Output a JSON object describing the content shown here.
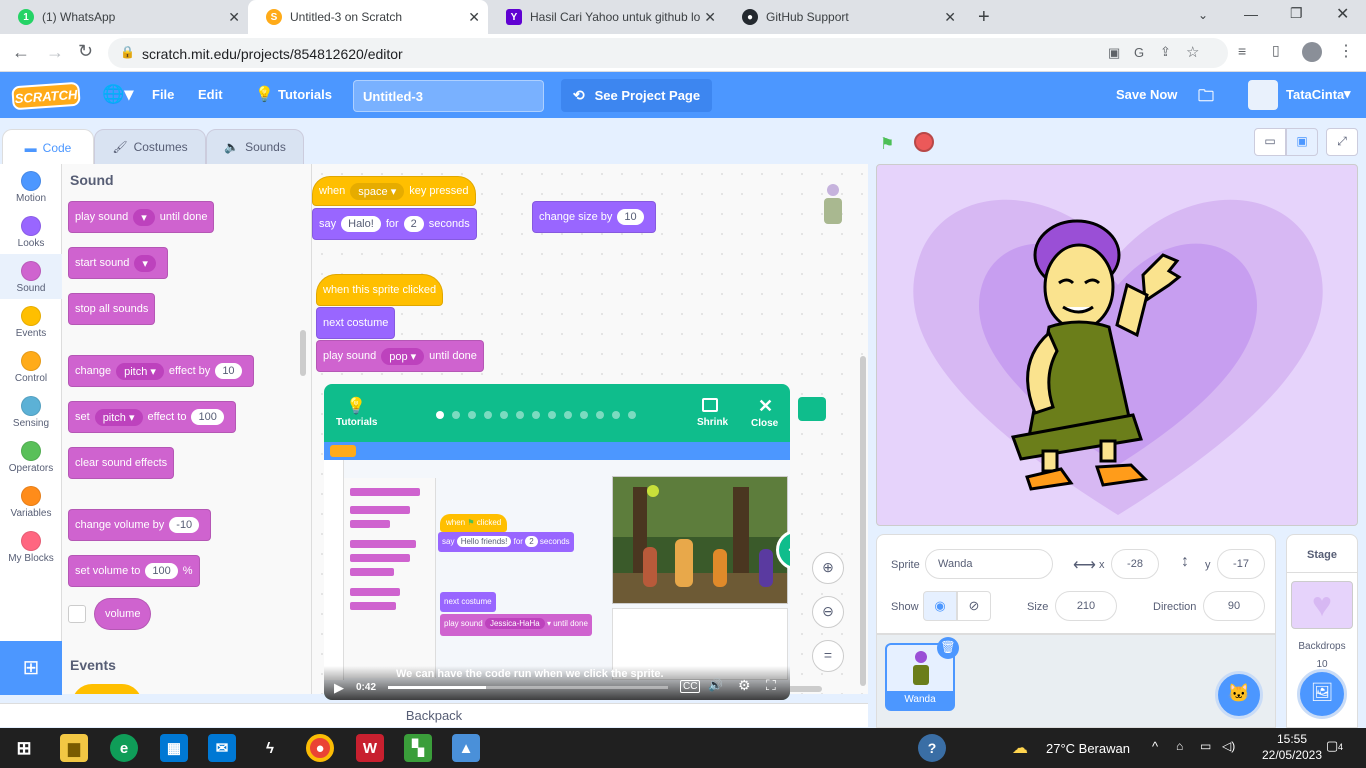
{
  "browser": {
    "tabs": [
      {
        "title": "(1) WhatsApp",
        "color": "#25d366",
        "glyph": "1"
      },
      {
        "title": "Untitled-3 on Scratch",
        "color": "#ffab19",
        "glyph": "S"
      },
      {
        "title": "Hasil Cari Yahoo untuk github log",
        "color": "#6001d2",
        "glyph": "Y"
      },
      {
        "title": "GitHub Support",
        "color": "#24292f",
        "glyph": "●"
      }
    ],
    "url": "scratch.mit.edu/projects/854812620/editor"
  },
  "menubar": {
    "logo": "SCRATCH",
    "file": "File",
    "edit": "Edit",
    "tutorials": "Tutorials",
    "project_title": "Untitled-3",
    "see_project": "See Project Page",
    "save_now": "Save Now",
    "username": "TataCinta"
  },
  "editor_tabs": {
    "code": "Code",
    "costumes": "Costumes",
    "sounds": "Sounds"
  },
  "categories": [
    {
      "label": "Motion",
      "color": "#4c97ff"
    },
    {
      "label": "Looks",
      "color": "#9966ff"
    },
    {
      "label": "Sound",
      "color": "#cf63cf"
    },
    {
      "label": "Events",
      "color": "#ffbf00"
    },
    {
      "label": "Control",
      "color": "#ffab19"
    },
    {
      "label": "Sensing",
      "color": "#5cb1d6"
    },
    {
      "label": "Operators",
      "color": "#59c059"
    },
    {
      "label": "Variables",
      "color": "#ff8c1a"
    },
    {
      "label": "My Blocks",
      "color": "#ff6680"
    }
  ],
  "palette": {
    "sound_heading": "Sound",
    "play_sound": "play sound",
    "until_done": "until done",
    "start_sound": "start sound",
    "stop_all": "stop all sounds",
    "change": "change",
    "pitch": "pitch",
    "effect_by": "effect by",
    "effect_by_value": "10",
    "set": "set",
    "effect_to": "effect to",
    "effect_to_value": "100",
    "clear_effects": "clear sound effects",
    "change_volume": "change volume by",
    "change_volume_value": "-10",
    "set_volume": "set volume to",
    "set_volume_value": "100",
    "percent": "%",
    "volume": "volume",
    "events_heading": "Events"
  },
  "scripts": {
    "when": "when",
    "key": "space",
    "key_pressed": "key pressed",
    "say": "say",
    "say_text": "Halo!",
    "for": "for",
    "secs": "2",
    "seconds": "seconds",
    "change_size": "change size by",
    "change_size_value": "10",
    "sprite_clicked": "when this sprite clicked",
    "next_costume": "next costume",
    "play_sound": "play sound",
    "sound_name": "pop",
    "until_done": "until done"
  },
  "backpack": "Backpack",
  "tutorial": {
    "label": "Tutorials",
    "shrink": "Shrink",
    "close": "Close",
    "dots": 13,
    "active_dot": 0,
    "caption": "We can have the code run when we click the sprite.",
    "time": "0:42",
    "progress": 0.35,
    "video_blocks": {
      "when": "when",
      "clicked": "clicked",
      "say": "say",
      "hello": "Hello friends!",
      "for": "for",
      "secs": "2",
      "seconds": "seconds",
      "next_costume": "next costume",
      "play_sound": "play sound",
      "sound": "Jessica-HaHa",
      "until_done": "until done"
    }
  },
  "sprite": {
    "sprite_label": "Sprite",
    "name": "Wanda",
    "x_label": "x",
    "x": "-28",
    "y_label": "y",
    "y": "-17",
    "show_label": "Show",
    "size_label": "Size",
    "size": "210",
    "direction_label": "Direction",
    "direction": "90",
    "thumb_name": "Wanda"
  },
  "stage_pane": {
    "title": "Stage",
    "backdrops_label": "Backdrops",
    "backdrops_count": "10"
  },
  "taskbar": {
    "weather": "27°C  Berawan",
    "time": "15:55",
    "date": "22/05/2023",
    "notif": "4"
  }
}
